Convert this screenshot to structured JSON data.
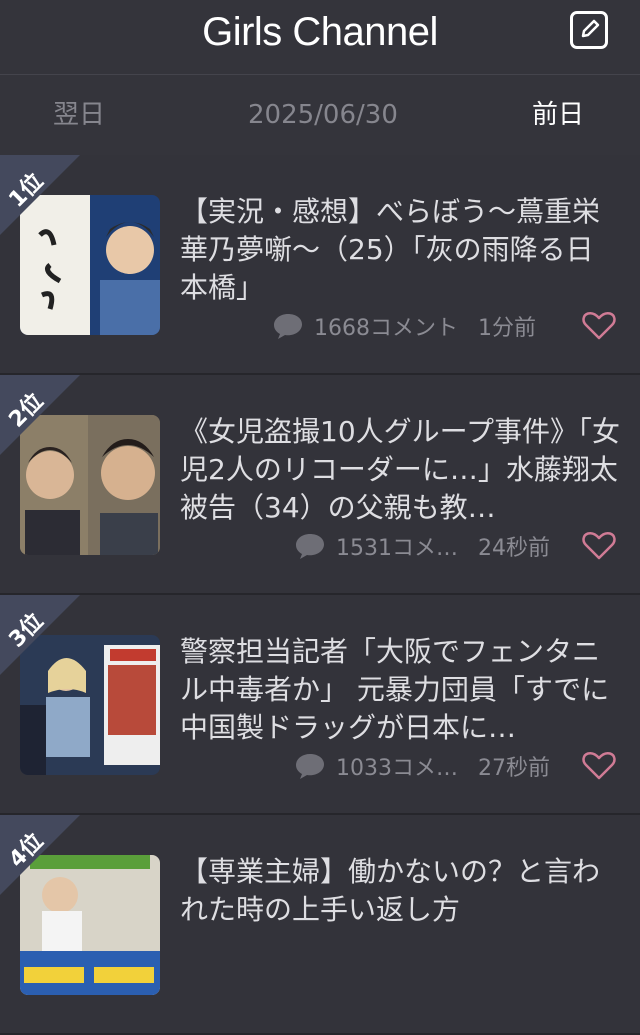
{
  "header": {
    "title": "Girls Channel",
    "compose_icon": "compose-icon"
  },
  "datebar": {
    "next": "翌日",
    "date": "2025/06/30",
    "prev": "前日"
  },
  "colors": {
    "background": "#2f2f36",
    "heart": "#d07b95",
    "rank": "#44495d"
  },
  "items": [
    {
      "rank": "1位",
      "title": "【実況・感想】べらぼう～蔦重栄華乃夢噺～（25）「灰の雨降る日本橋」",
      "comments": "1668コメント",
      "time": "1分前"
    },
    {
      "rank": "2位",
      "title": "《女児盗撮10人グループ事件》「女児2人のリコーダーに…」水藤翔太被告（34）の父親も教…",
      "comments": "1531コメ…",
      "time": "24秒前"
    },
    {
      "rank": "3位",
      "title": "警察担当記者「大阪でフェンタニル中毒者か」 元暴力団員「すでに中国製ドラッグが日本に…",
      "comments": "1033コメ…",
      "time": "27秒前"
    },
    {
      "rank": "4位",
      "title": "【専業主婦】働かないの？と言われた時の上手い返し方",
      "comments": "",
      "time": ""
    }
  ]
}
